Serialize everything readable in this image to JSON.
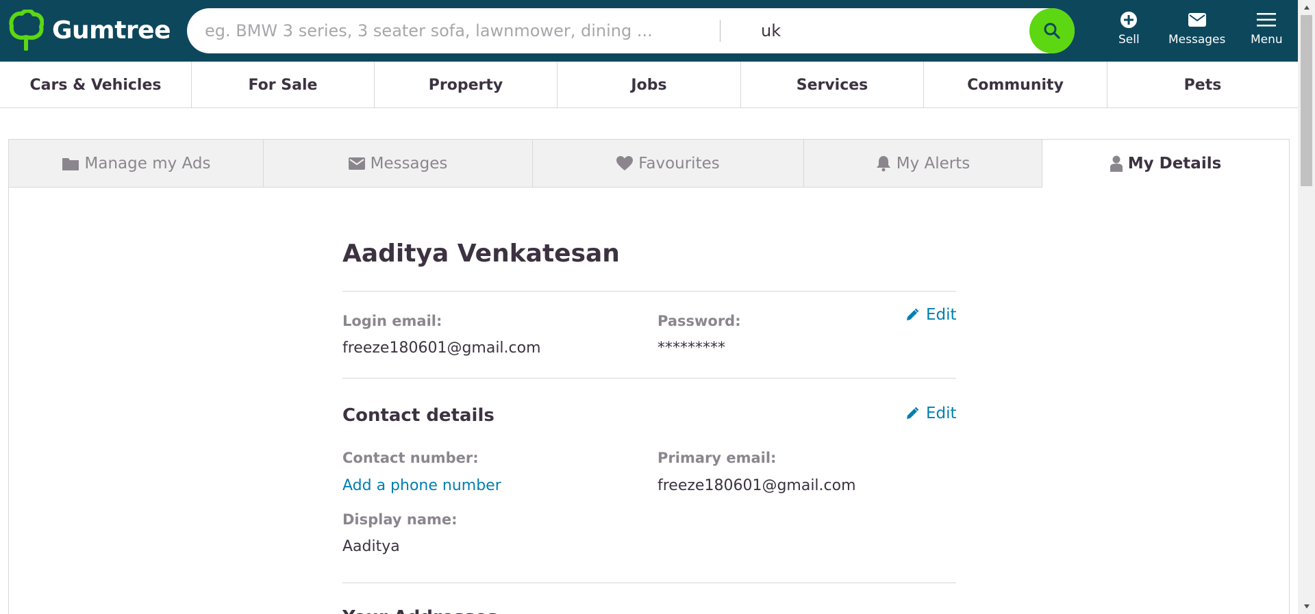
{
  "header": {
    "logo_text": "Gumtree",
    "search_placeholder": "eg. BMW 3 series, 3 seater sofa, lawnmower, dining ...",
    "location_value": "uk",
    "actions": [
      {
        "label": "Sell",
        "icon": "plus-circle-icon"
      },
      {
        "label": "Messages",
        "icon": "envelope-icon"
      },
      {
        "label": "Menu",
        "icon": "hamburger-icon"
      }
    ]
  },
  "categories": [
    "Cars & Vehicles",
    "For Sale",
    "Property",
    "Jobs",
    "Services",
    "Community",
    "Pets"
  ],
  "account_tabs": [
    {
      "label": "Manage my Ads",
      "icon": "folder-icon",
      "active": false
    },
    {
      "label": "Messages",
      "icon": "envelope-icon",
      "active": false
    },
    {
      "label": "Favourites",
      "icon": "heart-icon",
      "active": false
    },
    {
      "label": "My Alerts",
      "icon": "bell-icon",
      "active": false
    },
    {
      "label": "My Details",
      "icon": "user-icon",
      "active": true
    }
  ],
  "details": {
    "name": "Aaditya Venkatesan",
    "login": {
      "email_label": "Login email:",
      "email_value": "freeze180601@gmail.com",
      "password_label": "Password:",
      "password_value": "*********",
      "edit_label": "Edit"
    },
    "contact": {
      "title": "Contact details",
      "edit_label": "Edit",
      "number_label": "Contact number:",
      "number_link": "Add a phone number",
      "primary_email_label": "Primary email:",
      "primary_email_value": "freeze180601@gmail.com",
      "display_name_label": "Display name:",
      "display_name_value": "Aaditya"
    },
    "next_section_title": "Your Addresses"
  },
  "colors": {
    "header_bg": "#0d475c",
    "search_button": "#5cd712",
    "link": "#007fb0",
    "logo_green": "#5cd712"
  }
}
